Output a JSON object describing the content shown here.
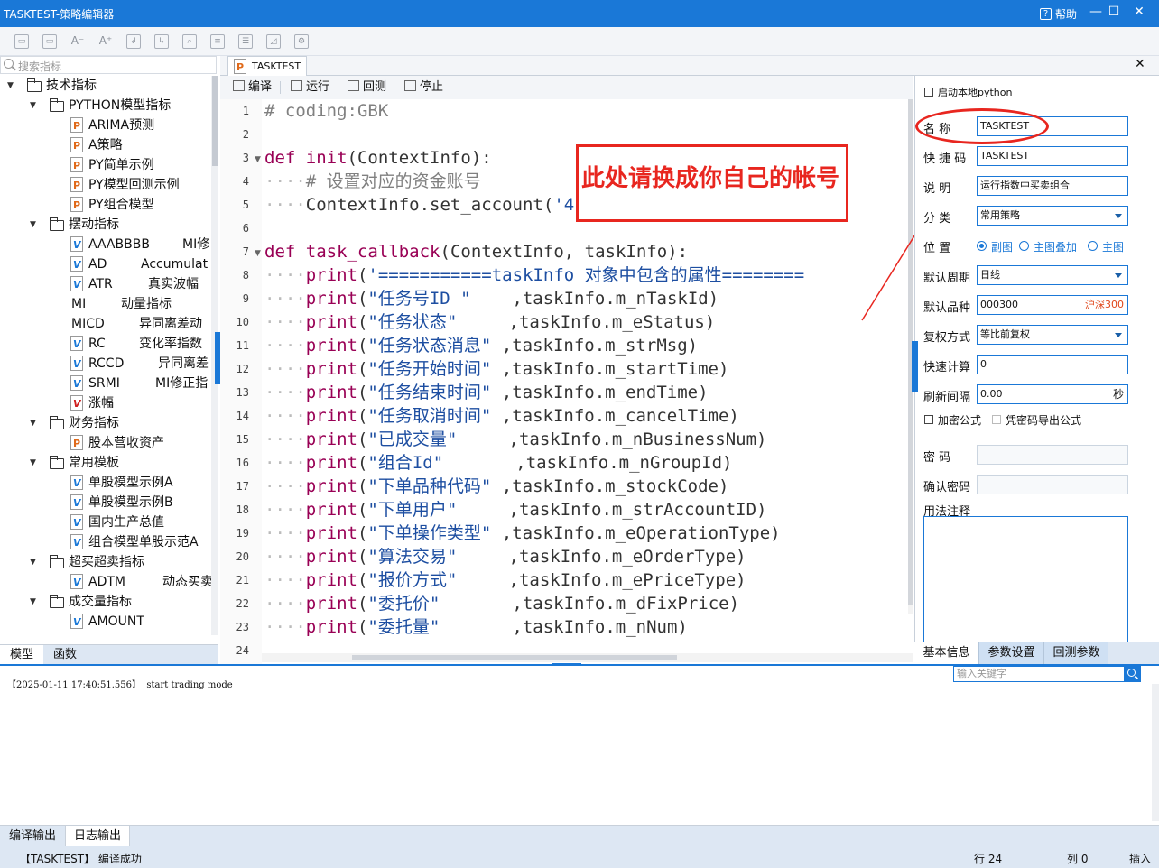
{
  "window": {
    "title": "TASKTEST-策略编辑器",
    "help_label": "帮助",
    "minimize_glyph": "—",
    "maximize_glyph": "☐",
    "close_glyph": "✕"
  },
  "toolbar": {
    "icons": [
      "save-icon",
      "save-all-icon",
      "font-decrease-icon",
      "font-increase-icon",
      "import-icon",
      "export-icon",
      "find-icon",
      "compile-file-icon",
      "list-icon",
      "chart-icon",
      "debug-icon"
    ]
  },
  "left": {
    "search_placeholder": "搜索指标",
    "tree": [
      {
        "label": "技术指标",
        "kind": "folder"
      },
      {
        "label": "PYTHON模型指标",
        "kind": "folder"
      },
      {
        "label": "ARIMA预测",
        "kind": "py"
      },
      {
        "label": "A策略",
        "kind": "py"
      },
      {
        "label": "PY简单示例",
        "kind": "py"
      },
      {
        "label": "PY模型回测示例",
        "kind": "py"
      },
      {
        "label": "PY组合模型",
        "kind": "py"
      },
      {
        "label": "摆动指标",
        "kind": "folder"
      },
      {
        "label": "AAABBBB",
        "desc": "MI修",
        "kind": "v"
      },
      {
        "label": "AD",
        "desc": "Accumulat",
        "kind": "v"
      },
      {
        "label": "ATR",
        "desc": "真实波幅",
        "kind": "v"
      },
      {
        "label": "MI",
        "desc": "动量指标",
        "kind": "plain"
      },
      {
        "label": "MICD",
        "desc": "异同离差动",
        "kind": "plain"
      },
      {
        "label": "RC",
        "desc": "变化率指数",
        "kind": "v"
      },
      {
        "label": "RCCD",
        "desc": "异同离差",
        "kind": "v"
      },
      {
        "label": "SRMI",
        "desc": "MI修正指",
        "kind": "v"
      },
      {
        "label": "涨幅",
        "kind": "v2"
      },
      {
        "label": "财务指标",
        "kind": "folder"
      },
      {
        "label": "股本营收资产",
        "kind": "py"
      },
      {
        "label": "常用模板",
        "kind": "folder"
      },
      {
        "label": "单股模型示例A",
        "kind": "v"
      },
      {
        "label": "单股模型示例B",
        "kind": "v"
      },
      {
        "label": "国内生产总值",
        "kind": "v"
      },
      {
        "label": "组合模型单股示范A",
        "kind": "v"
      },
      {
        "label": "超买超卖指标",
        "kind": "folder"
      },
      {
        "label": "ADTM",
        "desc": "动态买卖",
        "kind": "v"
      },
      {
        "label": "成交量指标",
        "kind": "folder"
      },
      {
        "label": "AMOUNT",
        "kind": "v"
      }
    ],
    "tabs": [
      "模型",
      "函数"
    ]
  },
  "document": {
    "tab_label": "TASKTEST",
    "close_glyph": "✕",
    "toolbar": [
      "编译",
      "运行",
      "回测",
      "停止"
    ]
  },
  "code": {
    "line_numbers": [
      "1",
      "2",
      "3",
      "4",
      "5",
      "6",
      "7",
      "8",
      "9",
      "10",
      "11",
      "12",
      "13",
      "14",
      "15",
      "16",
      "17",
      "18",
      "19",
      "20",
      "21",
      "22",
      "23",
      "24"
    ],
    "lines": [
      "# coding:GBK",
      "",
      "def init(ContextInfo):",
      "    # 设置对应的资金账号",
      "    ContextInfo.set_account('410038216969')",
      "",
      "def task_callback(ContextInfo, taskInfo):",
      "    print('===========taskInfo 对象中包含的属性========",
      "    print(\"任务号ID \"    ,taskInfo.m_nTaskId)",
      "    print(\"任务状态\"     ,taskInfo.m_eStatus)",
      "    print(\"任务状态消息\" ,taskInfo.m_strMsg)",
      "    print(\"任务开始时间\" ,taskInfo.m_startTime)",
      "    print(\"任务结束时间\" ,taskInfo.m_endTime)",
      "    print(\"任务取消时间\" ,taskInfo.m_cancelTime)",
      "    print(\"已成交量\"     ,taskInfo.m_nBusinessNum)",
      "    print(\"组合Id\"       ,taskInfo.m_nGroupId)",
      "    print(\"下单品种代码\" ,taskInfo.m_stockCode)",
      "    print(\"下单用户\"     ,taskInfo.m_strAccountID)",
      "    print(\"下单操作类型\" ,taskInfo.m_eOperationType)",
      "    print(\"算法交易\"     ,taskInfo.m_eOrderType)",
      "    print(\"报价方式\"     ,taskInfo.m_ePriceType)",
      "    print(\"委托价\"       ,taskInfo.m_dFixPrice)",
      "    print(\"委托量\"       ,taskInfo.m_nNum)",
      ""
    ]
  },
  "annotation": {
    "text": "此处请换成你自己的帐号",
    "color": "#e8261f"
  },
  "props": {
    "local_python_label": "启动本地python",
    "name_label": "名    称",
    "name_value": "TASKTEST",
    "shortcut_label": "快 捷 码",
    "shortcut_value": "TASKTEST",
    "desc_label": "说    明",
    "desc_value": "运行指数中买卖组合",
    "category_label": "分    类",
    "category_value": "常用策略",
    "position_label": "位    置",
    "position_options": [
      "副图",
      "主图叠加",
      "主图"
    ],
    "period_label": "默认周期",
    "period_value": "日线",
    "variety_label": "默认品种",
    "variety_value": "000300",
    "variety_name": "沪深300",
    "adjust_label": "复权方式",
    "adjust_value": "等比前复权",
    "fastcalc_label": "快速计算",
    "fastcalc_value": "0",
    "refresh_label": "刷新间隔",
    "refresh_value": "0.00",
    "refresh_unit": "秒",
    "encrypt_label": "加密公式",
    "export_label": "凭密码导出公式",
    "password_label": "密    码",
    "confirm_label": "确认密码",
    "notes_label": "用法注释",
    "tabs": [
      "基本信息",
      "参数设置",
      "回测参数"
    ]
  },
  "log": {
    "line": "【2025-01-11 17:40:51.556】  start trading mode",
    "search_placeholder": "输入关键字"
  },
  "bottom_tabs": [
    "编译输出",
    "日志输出"
  ],
  "status": {
    "message": "【TASKTEST】 编译成功",
    "row": "行 24",
    "col": "列 0",
    "mode": "插入"
  },
  "colors": {
    "accent": "#1a78d7",
    "annotation": "#e8261f",
    "keyword": "#990055",
    "string": "#1d4ea1"
  }
}
